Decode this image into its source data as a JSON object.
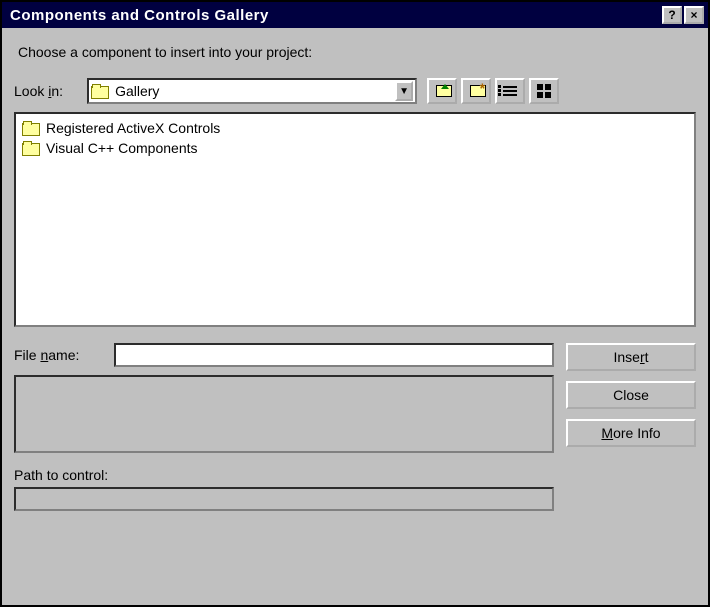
{
  "titlebar": {
    "title": "Components and Controls Gallery",
    "help_tooltip": "Help",
    "close_tooltip": "Close"
  },
  "prompt": "Choose a component to insert into your project:",
  "lookin": {
    "label_pre": "Look ",
    "label_mnemonic": "i",
    "label_post": "n:",
    "value": "Gallery"
  },
  "toolbar": {
    "up_tooltip": "Up One Level",
    "new_tooltip": "Create New Folder",
    "list_tooltip": "List",
    "details_tooltip": "Details"
  },
  "list": {
    "items": [
      "Registered ActiveX Controls",
      "Visual C++ Components"
    ]
  },
  "filename": {
    "label_pre": "File ",
    "label_mnemonic": "n",
    "label_post": "ame:",
    "value": ""
  },
  "path": {
    "label": "Path to control:",
    "value": ""
  },
  "buttons": {
    "insert_pre": "Inse",
    "insert_mnemonic": "r",
    "insert_post": "t",
    "close": "Close",
    "moreinfo_mnemonic": "M",
    "moreinfo_post": "ore Info"
  }
}
